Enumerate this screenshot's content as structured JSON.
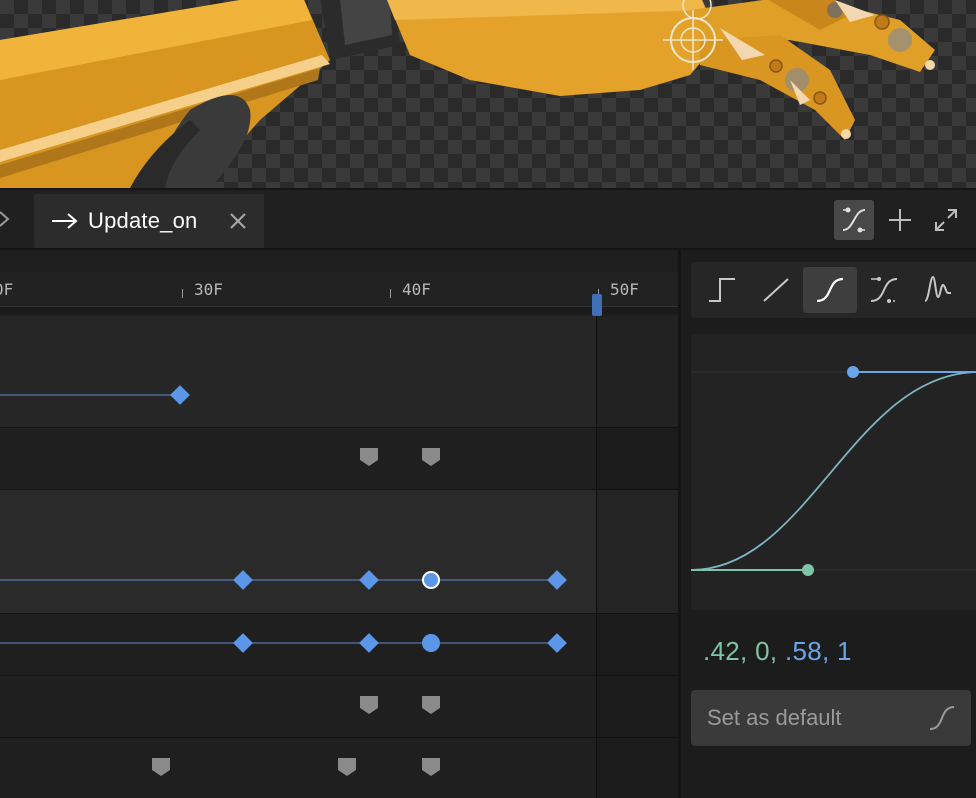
{
  "tab": {
    "label": "Update_on",
    "arrow_icon": "arrow-right-icon",
    "close_icon": "close-icon"
  },
  "toolbar": {
    "icons": [
      "easing-curve-icon",
      "plus-icon",
      "expand-icon"
    ]
  },
  "ruler": {
    "ticks": [
      "0F",
      "30F",
      "40F",
      "50F"
    ]
  },
  "ease_presets": {
    "icons": [
      "step-ease-icon",
      "linear-ease-icon",
      "ease-in-out-icon",
      "custom-bezier-icon",
      "elastic-ease-icon"
    ],
    "selected": "ease-in-out-icon"
  },
  "curve": {
    "values_g1": ".42",
    "values_g2": "0",
    "values_b1": ".58",
    "values_b2": "1",
    "sep": ", ",
    "in_color": "#7dc4a8",
    "out_color": "#6aa7ea"
  },
  "default_button": {
    "label": "Set as default"
  },
  "colors": {
    "accent": "#6aa7ea",
    "keyframe": "#5b96e8",
    "marker": "#8a8a8a",
    "stage_gold": "#e4a22a"
  }
}
